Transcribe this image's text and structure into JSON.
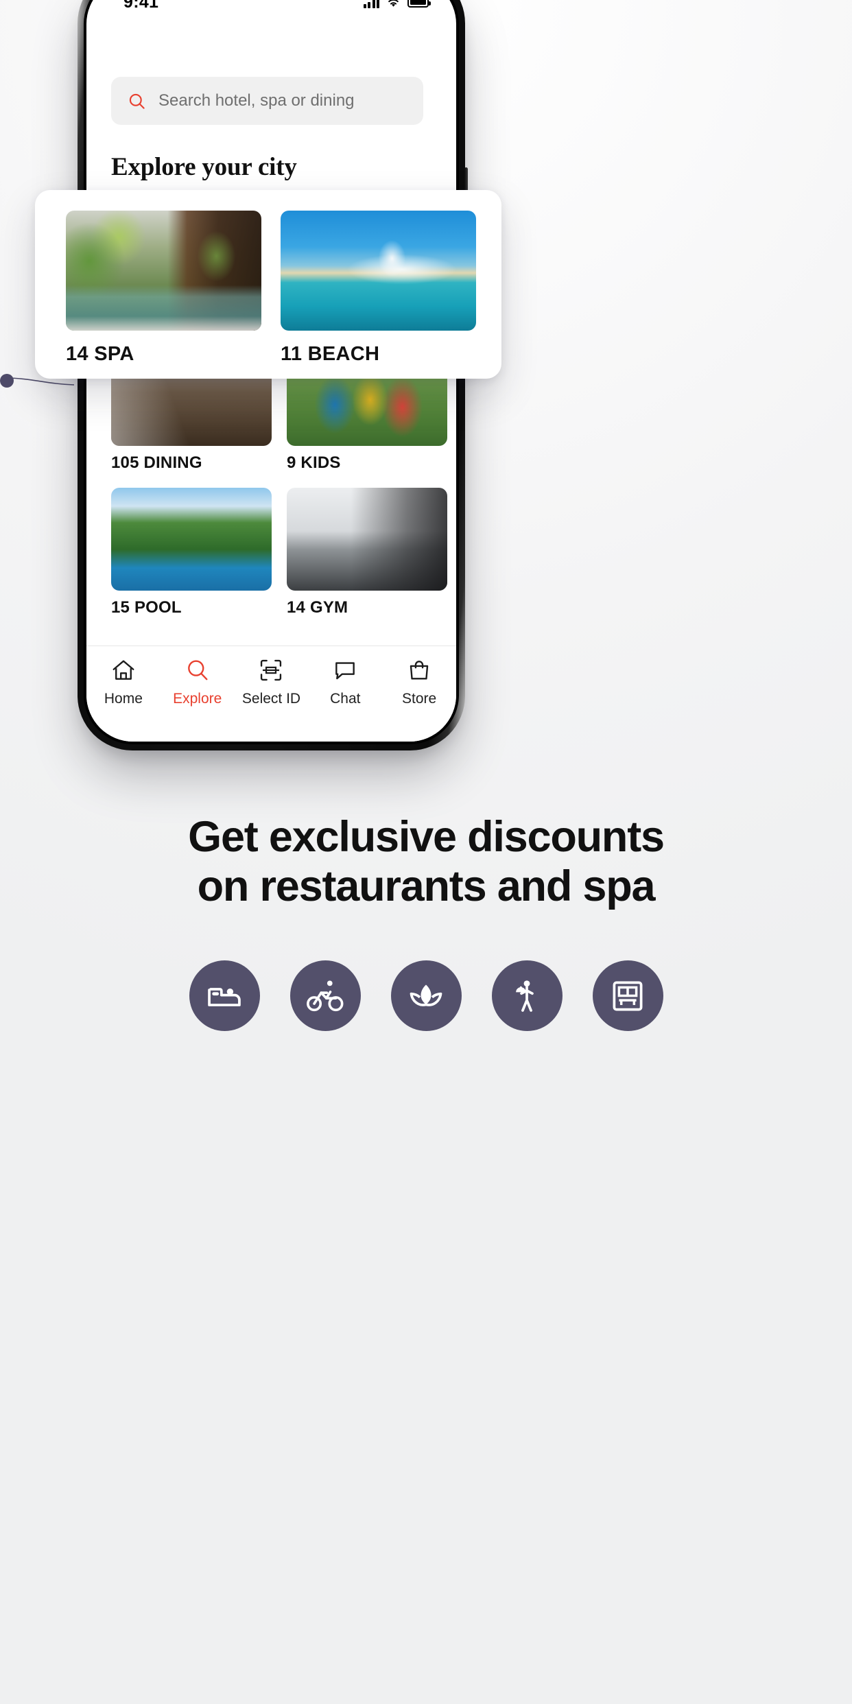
{
  "phone": {
    "status_bar": {
      "time": "9:41",
      "icons": [
        "signal-bars-icon",
        "wifi-icon",
        "battery-icon"
      ]
    },
    "search": {
      "icon": "search-icon",
      "placeholder": "Search hotel, spa or dining",
      "value": ""
    },
    "section_title": "Explore your city",
    "categories": [
      {
        "count": "14",
        "name": "SPA",
        "label": "14 SPA",
        "image": "spa-pool-photo"
      },
      {
        "count": "11",
        "name": "BEACH",
        "label": "11 BEACH",
        "image": "beach-photo"
      },
      {
        "count": "105",
        "name": "DINING",
        "label": "105 DINING",
        "image": "dining-photo"
      },
      {
        "count": "9",
        "name": "KIDS",
        "label": "9 KIDS",
        "image": "kids-playground-photo"
      },
      {
        "count": "15",
        "name": "POOL",
        "label": "15 POOL",
        "image": "pool-photo"
      },
      {
        "count": "14",
        "name": "GYM",
        "label": "14 GYM",
        "image": "gym-photo"
      }
    ],
    "highlighted_cards": [
      {
        "label": "14 SPA",
        "image": "spa-pool-photo"
      },
      {
        "label": "11 BEACH",
        "image": "beach-photo"
      }
    ],
    "tabbar": {
      "active": "Explore",
      "active_color": "#e8402f",
      "items": [
        {
          "label": "Home",
          "icon": "home-icon"
        },
        {
          "label": "Explore",
          "icon": "search-icon"
        },
        {
          "label": "Select ID",
          "icon": "scan-id-icon"
        },
        {
          "label": "Chat",
          "icon": "chat-bubble-icon"
        },
        {
          "label": "Store",
          "icon": "shopping-bag-icon"
        }
      ]
    }
  },
  "promo": {
    "headline_line1": "Get exclusive discounts",
    "headline_line2": "on restaurants and spa",
    "circle_color": "#53506b",
    "icons": [
      {
        "name": "bed-icon"
      },
      {
        "name": "bicycle-icon"
      },
      {
        "name": "lotus-flower-icon"
      },
      {
        "name": "concierge-waiter-icon"
      },
      {
        "name": "tram-bus-icon"
      }
    ]
  }
}
